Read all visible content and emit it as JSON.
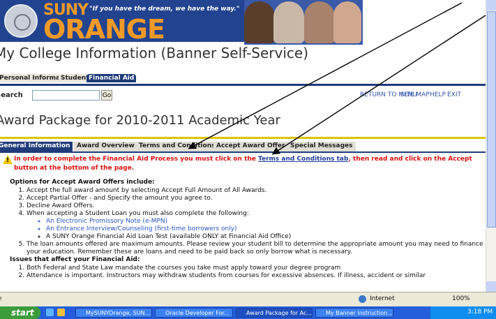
{
  "banner": {
    "logo_suny": "SUNY",
    "logo_tagline": "\"If you have the dream, we have the way.\"",
    "logo_orange": "ORANGE"
  },
  "app_title": "My College Information (Banner Self-Service)",
  "top_nav": {
    "personal": "Personal Information",
    "student": "Student",
    "financial_aid": "Financial Aid"
  },
  "search": {
    "label": "Search",
    "value": "",
    "go_label": "Go"
  },
  "top_links": {
    "return": "RETURN TO MENU",
    "site_map": "SITE MAP",
    "help": "HELP",
    "exit": "EXIT"
  },
  "page_heading": "Award Package for 2010-2011 Academic Year",
  "section_tabs": {
    "general": "General Information",
    "overview": "Award Overview",
    "terms": "Terms and Conditions",
    "accept": "Accept Award Offer",
    "special": "Special Messages"
  },
  "warning": {
    "before": "In order to complete the Financial Aid Process you must click on the ",
    "link": "Terms and Conditions tab",
    "after": ", then read and click on the Accept button at the bottom of the page."
  },
  "options": {
    "heading": "Options for Accept Award Offers include:",
    "items": [
      "Accept the full award amount by selecting Accept Full Amount of All Awards.",
      "Accept Partial Offer - and Specify the amount you agree to.",
      "Decline Award Offers.",
      "When accepting a Student Loan you must also complete the following:",
      "The loan amounts offered are maximum amounts. Please review your student bill to determine the appropriate amount you may need to finance your education. Remember these are loans and need to be paid back so only borrow what is necessary."
    ],
    "sub_items": [
      "An Electronic Promissory Note (e-MPN)",
      "An Entrance Interview/Counseling (first-time borrowers only)",
      "A SUNY Orange Financial Aid Loan Test (available ONLY at Financial Aid Office)"
    ]
  },
  "issues": {
    "heading": "Issues that affect your Financial Aid:",
    "items": [
      "Both Federal and State Law mandate the courses you take must apply toward your degree program",
      "Attendance is important. Instructors may withdraw students from courses for excessive absences. If illness, accident or similar"
    ]
  },
  "statusbar": {
    "left": "e",
    "zone": "Internet",
    "zoom": "100%"
  },
  "taskbar": {
    "start": "start",
    "tasks": [
      "MySUNYOrange, SUN...",
      "Oracle Developer For...",
      "Award Package for Ac...",
      "My Banner instruction..."
    ],
    "clock": "3:18 PM"
  }
}
